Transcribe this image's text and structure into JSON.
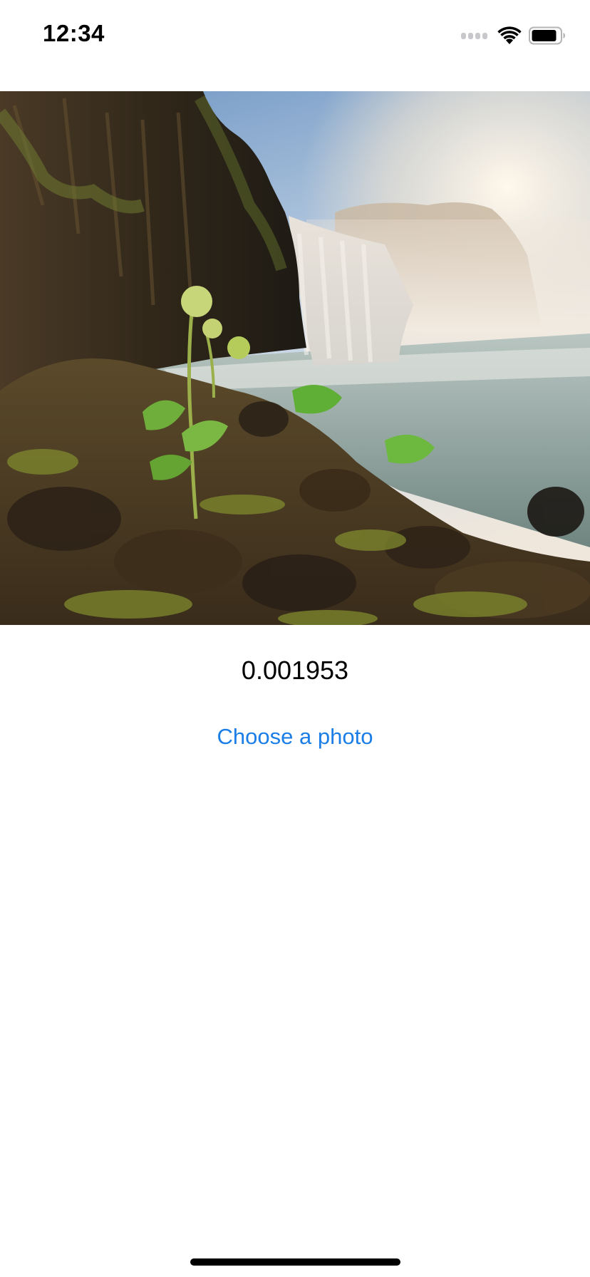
{
  "status_bar": {
    "time": "12:34",
    "icons": [
      "cellular-signal-icon",
      "wifi-icon",
      "battery-icon"
    ],
    "battery_fill_fraction": 0.75
  },
  "image": {
    "description_icon": "waterfall-landscape-photo"
  },
  "result": {
    "value": "0.001953"
  },
  "actions": {
    "choose_photo_label": "Choose a photo"
  },
  "colors": {
    "accent": "#1a7ee6",
    "text": "#000000",
    "background": "#ffffff"
  }
}
